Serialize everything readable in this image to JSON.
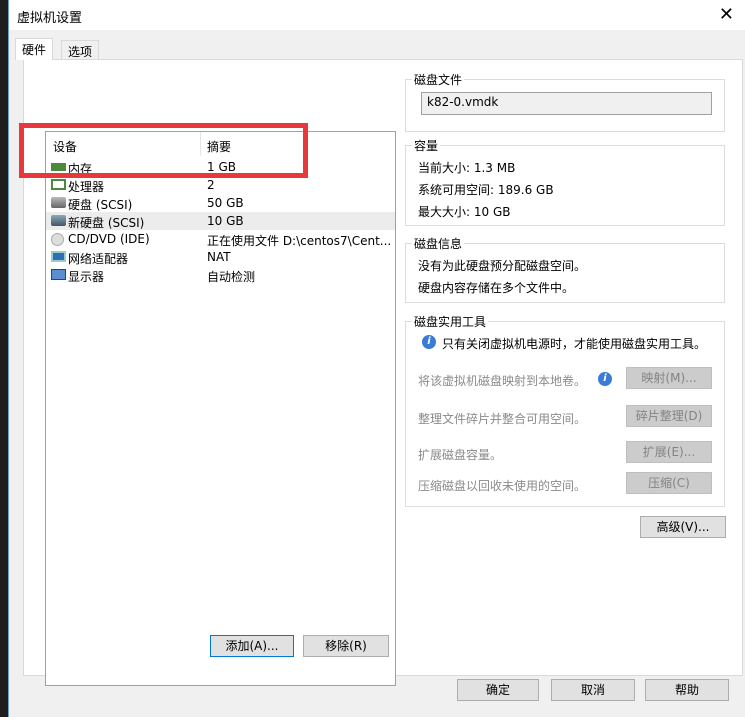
{
  "window": {
    "title": "虚拟机设置",
    "close": "✕"
  },
  "tabs": [
    {
      "label": "硬件"
    },
    {
      "label": "选项"
    }
  ],
  "devices": {
    "headers": {
      "device": "设备",
      "summary": "摘要"
    },
    "rows": [
      {
        "name": "内存",
        "summary": "1 GB",
        "icon": "memory-icon"
      },
      {
        "name": "处理器",
        "summary": "2",
        "icon": "cpu-icon"
      },
      {
        "name": "硬盘 (SCSI)",
        "summary": "50 GB",
        "icon": "hard-disk-icon"
      },
      {
        "name": "新硬盘 (SCSI)",
        "summary": "10 GB",
        "icon": "hard-disk-icon"
      },
      {
        "name": "CD/DVD (IDE)",
        "summary": "正在使用文件 D:\\centos7\\Cent...",
        "icon": "cd-icon"
      },
      {
        "name": "网络适配器",
        "summary": "NAT",
        "icon": "network-icon"
      },
      {
        "name": "显示器",
        "summary": "自动检测",
        "icon": "display-icon"
      }
    ],
    "add": "添加(A)...",
    "remove": "移除(R)"
  },
  "disk_file": {
    "label": "磁盘文件",
    "value": "k82-0.vmdk"
  },
  "capacity": {
    "label": "容量",
    "current": "当前大小: 1.3 MB",
    "available": "系统可用空间: 189.6 GB",
    "max": "最大大小: 10 GB"
  },
  "disk_info": {
    "label": "磁盘信息",
    "line1": "没有为此硬盘预分配磁盘空间。",
    "line2": "硬盘内容存储在多个文件中。"
  },
  "utilities": {
    "label": "磁盘实用工具",
    "notice": "只有关闭虚拟机电源时，才能使用磁盘实用工具。",
    "items": [
      {
        "desc": "将该虚拟机磁盘映射到本地卷。",
        "button": "映射(M)..."
      },
      {
        "desc": "整理文件碎片并整合可用空间。",
        "button": "碎片整理(D)"
      },
      {
        "desc": "扩展磁盘容量。",
        "button": "扩展(E)..."
      },
      {
        "desc": "压缩磁盘以回收未使用的空间。",
        "button": "压缩(C)"
      }
    ]
  },
  "advanced": "高级(V)...",
  "footer": {
    "ok": "确定",
    "cancel": "取消",
    "help": "帮助"
  }
}
